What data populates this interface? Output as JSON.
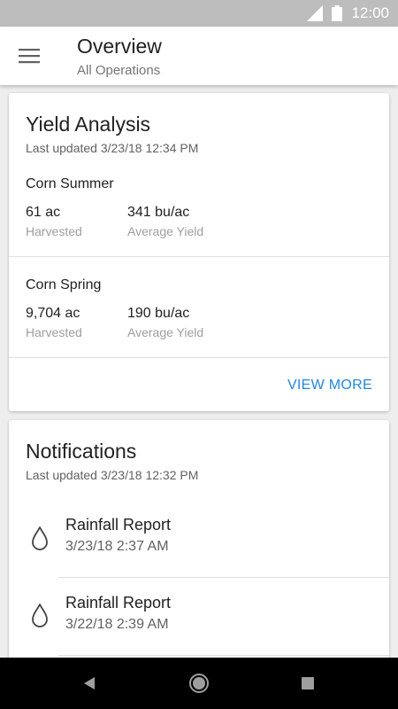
{
  "status_bar": {
    "time": "12:00",
    "icons": [
      "signal-icon",
      "battery-icon"
    ]
  },
  "app_bar": {
    "title": "Overview",
    "subtitle": "All Operations",
    "menu_icon": "hamburger-menu-icon"
  },
  "yield_analysis": {
    "title": "Yield Analysis",
    "updated": "Last updated 3/23/18 12:34 PM",
    "crops": [
      {
        "name": "Corn Summer",
        "harvested_value": "61 ac",
        "harvested_label": "Harvested",
        "yield_value": "341 bu/ac",
        "yield_label": "Average Yield"
      },
      {
        "name": "Corn Spring",
        "harvested_value": "9,704 ac",
        "harvested_label": "Harvested",
        "yield_value": "190 bu/ac",
        "yield_label": "Average Yield"
      }
    ],
    "view_more": "VIEW MORE",
    "accent_color": "#1e88e5"
  },
  "notifications": {
    "title": "Notifications",
    "updated": "Last updated 3/23/18 12:32 PM",
    "items": [
      {
        "icon": "water-drop-icon",
        "title": "Rainfall Report",
        "time": "3/23/18 2:37 AM"
      },
      {
        "icon": "water-drop-icon",
        "title": "Rainfall Report",
        "time": "3/22/18 2:39 AM"
      }
    ]
  },
  "nav_bar": {
    "buttons": [
      "back-icon",
      "home-icon",
      "recents-icon"
    ]
  }
}
